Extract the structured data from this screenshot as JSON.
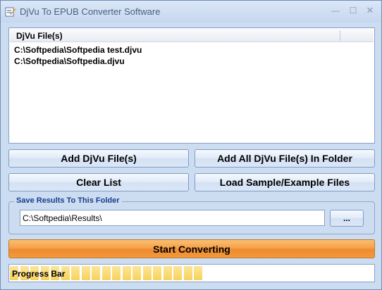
{
  "window": {
    "title": "DjVu To EPUB Converter Software",
    "minimize_glyph": "—",
    "maximize_glyph": "☐",
    "close_glyph": "✕"
  },
  "file_list": {
    "column_header": "DjVu File(s)",
    "rows": [
      "C:\\Softpedia\\Softpedia test.djvu",
      "C:\\Softpedia\\Softpedia.djvu"
    ]
  },
  "buttons": {
    "add_files": "Add DjVu File(s)",
    "add_all_in_folder": "Add All DjVu File(s) In Folder",
    "clear_list": "Clear List",
    "load_samples": "Load Sample/Example Files"
  },
  "output": {
    "group_label": "Save Results To This Folder",
    "path": "C:\\Softpedia\\Results\\",
    "browse_label": "..."
  },
  "start_label": "Start Converting",
  "progress": {
    "label": "Progress Bar",
    "fraction": 0.54,
    "fill_color": "#f7d25b"
  },
  "colors": {
    "window_bg": "#ccdcf1",
    "start_button": "#f5a14a",
    "group_label": "#1a3d8c"
  }
}
